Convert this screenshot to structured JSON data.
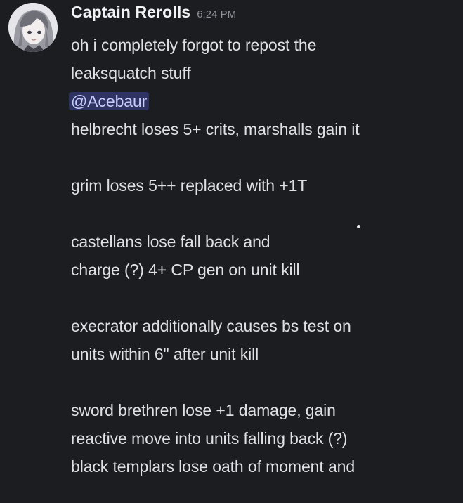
{
  "message": {
    "author": "Captain Rerolls",
    "timestamp": "6:24 PM",
    "lines": {
      "l1": "oh i completely forgot to repost the",
      "l2": "leaksquatch stuff",
      "mention": "@Acebaur",
      "l3": "helbrecht loses 5+ crits, marshalls gain it",
      "l4": "grim loses 5++ replaced with +1T",
      "l5": "castellans lose fall back and",
      "l6": "charge (?) 4+ CP gen on unit kill",
      "l7": "execrator additionally causes bs test on",
      "l8": "units within 6\" after unit kill",
      "l9": "sword brethren lose +1 damage, gain",
      "l10": "reactive move into units falling back (?)",
      "l11": "black templars lose oath of moment and"
    }
  },
  "colors": {
    "background": "#1c1d21",
    "text": "#dfe0e3",
    "username": "#f2f3f5",
    "timestamp": "#8e9199",
    "mention_bg": "#3f4474",
    "mention_text": "#c9cdfb"
  },
  "icons": {
    "avatar": "anime-character-avatar"
  }
}
